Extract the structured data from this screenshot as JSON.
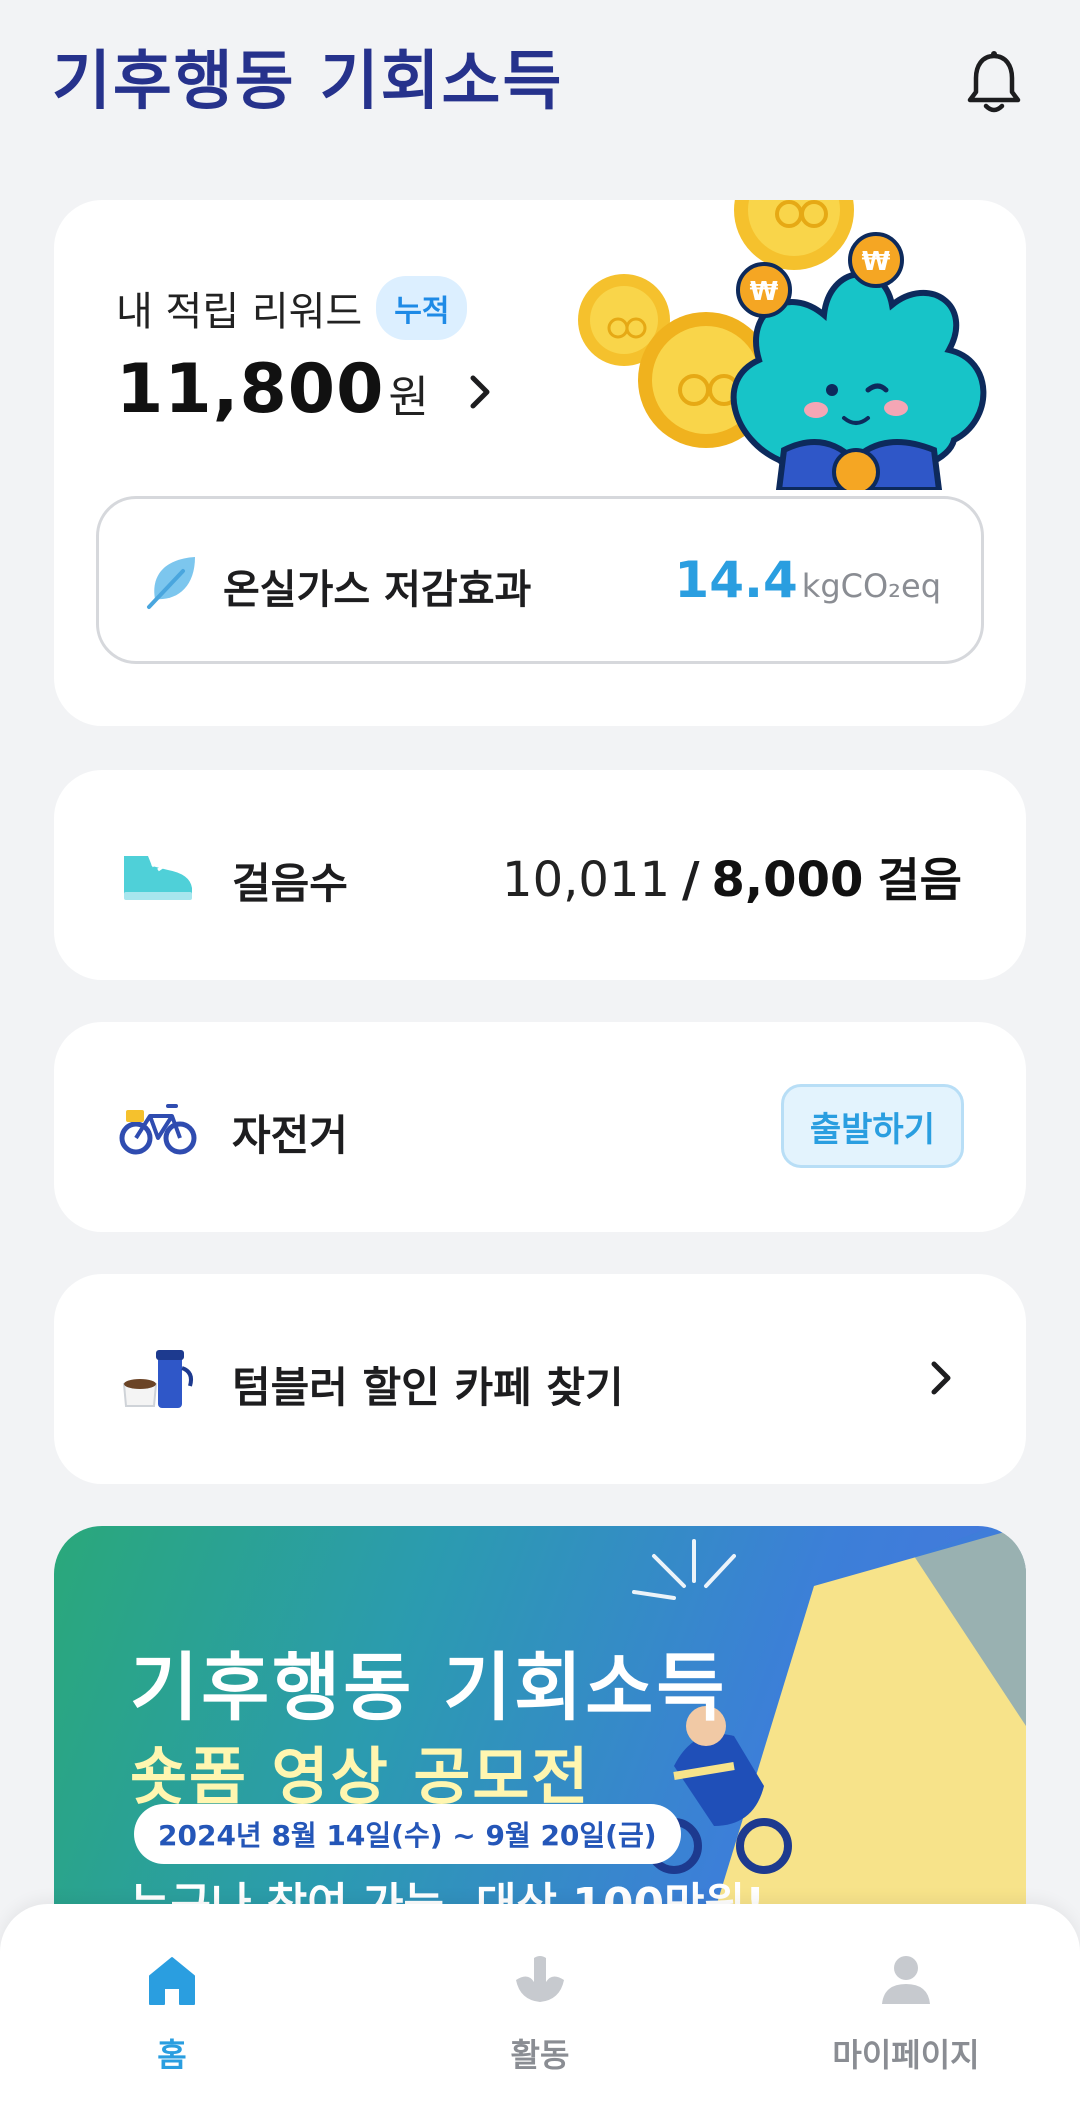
{
  "app": {
    "logo_text": "기후행동 기회소득"
  },
  "reward": {
    "title": "내 적립 리워드",
    "badge": "누적",
    "amount": "11,800",
    "unit": "원"
  },
  "ghg": {
    "label": "온실가스 저감효과",
    "value": "14.4",
    "unit": "kgCO₂eq"
  },
  "steps": {
    "label": "걸음수",
    "current": "10,011",
    "separator": "/",
    "goal": "8,000",
    "unit": "걸음"
  },
  "bike": {
    "label": "자전거",
    "button": "출발하기"
  },
  "tumbler": {
    "label": "텀블러 할인 카페 찾기"
  },
  "banner": {
    "title": "기후행동 기회소득",
    "subtitle": "숏폼 영상 공모전",
    "date": "2024년 8월 14일(수) ~ 9월 20일(금)",
    "cta": "누구나 참여 가능, 대상 100만원!"
  },
  "nav": {
    "home": "홈",
    "activity": "활동",
    "mypage": "마이페이지"
  },
  "colors": {
    "accent": "#2a9ee0",
    "logo": "#26328c",
    "background": "#f2f3f5",
    "inactive": "#8a8d93"
  },
  "icons": {
    "bell": "bell-icon",
    "leaf": "leaf-icon",
    "shoe": "shoe-icon",
    "bicycle": "bicycle-icon",
    "tumbler": "tumbler-icon",
    "home": "home-icon",
    "activity": "activity-icon",
    "mypage": "person-icon"
  }
}
